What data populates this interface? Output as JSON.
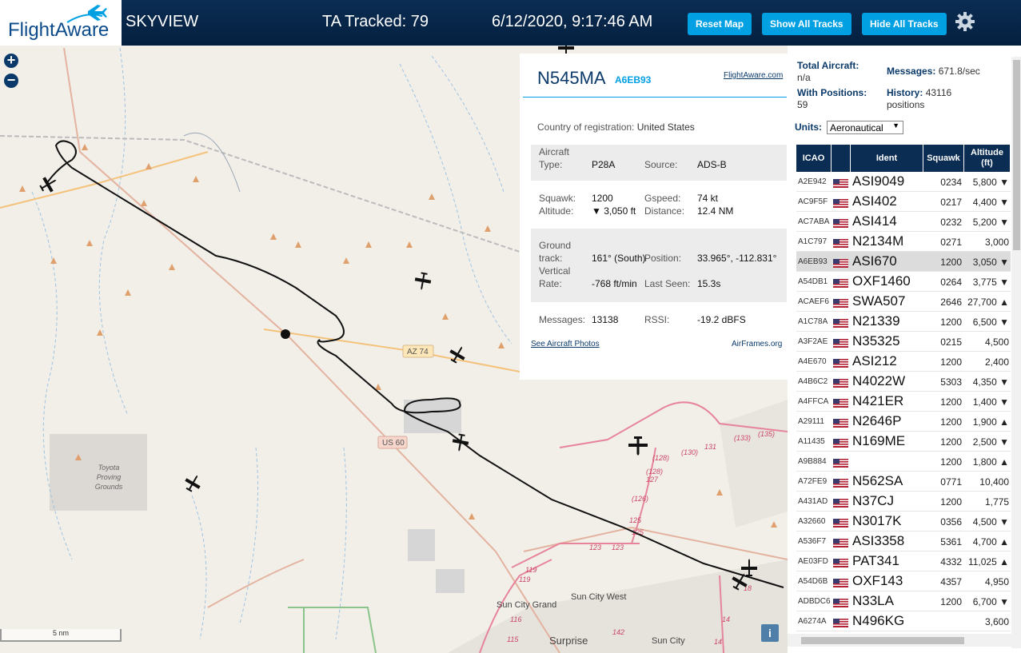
{
  "header": {
    "logo": "FlightAware",
    "app_name": "SKYVIEW",
    "tracked": "TA Tracked: 79",
    "datetime": "6/12/2020, 9:17:46 AM",
    "buttons": [
      "Reset Map",
      "Show All Tracks",
      "Hide All Tracks"
    ]
  },
  "map": {
    "zoom_in": "+",
    "zoom_out": "−",
    "scale": "5 nm",
    "info": "i",
    "labels": {
      "az74": "AZ 74",
      "us60": "US 60",
      "toyota": [
        "Toyota",
        "Proving",
        "Grounds"
      ],
      "sun_city_grand": "Sun City Grand",
      "sun_city_west": "Sun City West",
      "surprise": "Surprise",
      "sun_city": "Sun City",
      "roads": [
        "(128)",
        "(130)",
        "131",
        "(133)",
        "(135)",
        "(128)",
        "127",
        "(126)",
        "125",
        "125",
        "123",
        "123",
        "119",
        "119",
        "116",
        "115",
        "142",
        "14",
        "14",
        "18"
      ]
    }
  },
  "selected": {
    "registration": "N545MA",
    "icao": "A6EB93",
    "flightaware_link": "FlightAware.com",
    "country_label": "Country of registration:",
    "country": "United States",
    "aircraft_type_label": [
      "Aircraft",
      "Type:"
    ],
    "aircraft_type": "P28A",
    "source_label": "Source:",
    "source": "ADS-B",
    "squawk_label": "Squawk:",
    "squawk": "1200",
    "altitude_label": "Altitude:",
    "altitude": "▼ 3,050 ft",
    "gspeed_label": "Gspeed:",
    "gspeed": "74 kt",
    "distance_label": "Distance:",
    "distance": "12.4 NM",
    "ground_track_label": [
      "Ground",
      "track:"
    ],
    "ground_track": "161° (South)",
    "position_label": "Position:",
    "position": "33.965°, -112.831°",
    "vrate_label": [
      "Vertical",
      "Rate:"
    ],
    "vrate": "-768 ft/min",
    "last_seen_label": "Last Seen:",
    "last_seen": "15.3s",
    "messages_label": "Messages:",
    "messages": "13138",
    "rssi_label": "RSSI:",
    "rssi": "-19.2 dBFS",
    "photos_link": "See Aircraft Photos",
    "airframes_link": "AirFrames.org"
  },
  "sidebar": {
    "total_aircraft_label": "Total Aircraft:",
    "total_aircraft": "n/a",
    "messages_label": "Messages:",
    "messages": "671.8/sec",
    "with_positions_label": "With Positions:",
    "with_positions": "59",
    "history_label": "History:",
    "history": "43116",
    "history_unit": "positions",
    "units_label": "Units:",
    "units_value": "Aeronautical",
    "columns": [
      "ICAO",
      "",
      "Ident",
      "Squawk",
      "Altitude (ft)"
    ],
    "rows": [
      {
        "icao": "A2E942",
        "ident": "ASI9049",
        "squawk": "0234",
        "alt": "5,800 ▼"
      },
      {
        "icao": "AC9F5F",
        "ident": "ASI402",
        "squawk": "0217",
        "alt": "4,400 ▼"
      },
      {
        "icao": "AC7ABA",
        "ident": "ASI414",
        "squawk": "0232",
        "alt": "5,200 ▼"
      },
      {
        "icao": "A1C797",
        "ident": "N2134M",
        "squawk": "0271",
        "alt": "3,000"
      },
      {
        "icao": "A6EB93",
        "ident": "ASI670",
        "squawk": "1200",
        "alt": "3,050 ▼"
      },
      {
        "icao": "A54DB1",
        "ident": "OXF1460",
        "squawk": "0264",
        "alt": "3,775 ▼"
      },
      {
        "icao": "ACAEF6",
        "ident": "SWA507",
        "squawk": "2646",
        "alt": "27,700 ▲"
      },
      {
        "icao": "A1C78A",
        "ident": "N21339",
        "squawk": "1200",
        "alt": "6,500 ▼"
      },
      {
        "icao": "A3F2AE",
        "ident": "N35325",
        "squawk": "0215",
        "alt": "4,500"
      },
      {
        "icao": "A4E670",
        "ident": "ASI212",
        "squawk": "1200",
        "alt": "2,400"
      },
      {
        "icao": "A4B6C2",
        "ident": "N4022W",
        "squawk": "5303",
        "alt": "4,350 ▼"
      },
      {
        "icao": "A4FFCA",
        "ident": "N421ER",
        "squawk": "1200",
        "alt": "1,400 ▼"
      },
      {
        "icao": "A29111",
        "ident": "N2646P",
        "squawk": "1200",
        "alt": "1,900 ▲"
      },
      {
        "icao": "A11435",
        "ident": "N169ME",
        "squawk": "1200",
        "alt": "2,500 ▼"
      },
      {
        "icao": "A9B884",
        "ident": "",
        "squawk": "1200",
        "alt": "1,800 ▲"
      },
      {
        "icao": "A72FE9",
        "ident": "N562SA",
        "squawk": "0771",
        "alt": "10,400"
      },
      {
        "icao": "A431AD",
        "ident": "N37CJ",
        "squawk": "1200",
        "alt": "1,775"
      },
      {
        "icao": "A32660",
        "ident": "N3017K",
        "squawk": "0356",
        "alt": "4,500 ▼"
      },
      {
        "icao": "A536F7",
        "ident": "ASI3358",
        "squawk": "5361",
        "alt": "4,700 ▲"
      },
      {
        "icao": "AE03FD",
        "ident": "PAT341",
        "squawk": "4332",
        "alt": "11,025 ▲"
      },
      {
        "icao": "A54D6B",
        "ident": "OXF143",
        "squawk": "4357",
        "alt": "4,950"
      },
      {
        "icao": "ADBDC6",
        "ident": "N33LA",
        "squawk": "1200",
        "alt": "6,700 ▼"
      },
      {
        "icao": "A6274A",
        "ident": "N496KG",
        "squawk": "",
        "alt": "3,600"
      }
    ]
  },
  "colors": {
    "header": "#0b2c53",
    "accent": "#00a0e3",
    "selected_row": "#dcdcdc"
  }
}
